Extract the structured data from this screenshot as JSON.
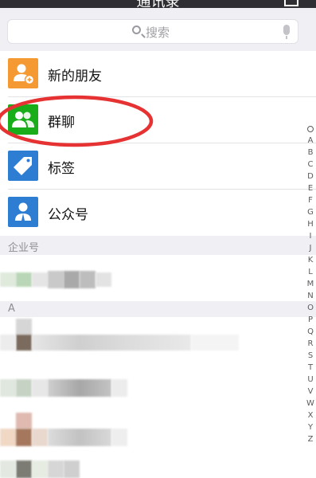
{
  "header": {
    "title": "通讯录"
  },
  "search": {
    "placeholder": "搜索"
  },
  "menu": [
    {
      "label": "新的朋友",
      "icon": "add-friend-icon",
      "color": "#f59a33"
    },
    {
      "label": "群聊",
      "icon": "group-chat-icon",
      "color": "#19ad19"
    },
    {
      "label": "标签",
      "icon": "tag-icon",
      "color": "#2d7dd2"
    },
    {
      "label": "公众号",
      "icon": "official-account-icon",
      "color": "#2d7dd2"
    }
  ],
  "sections": {
    "enterprise": "企业号",
    "a": "A"
  },
  "index_letters": [
    "A",
    "B",
    "C",
    "D",
    "E",
    "F",
    "G",
    "H",
    "I",
    "J",
    "K",
    "L",
    "M",
    "N",
    "O",
    "P",
    "Q",
    "R",
    "S",
    "T",
    "U",
    "V",
    "W",
    "X",
    "Y",
    "Z"
  ],
  "annotation": {
    "color": "#e63232"
  }
}
